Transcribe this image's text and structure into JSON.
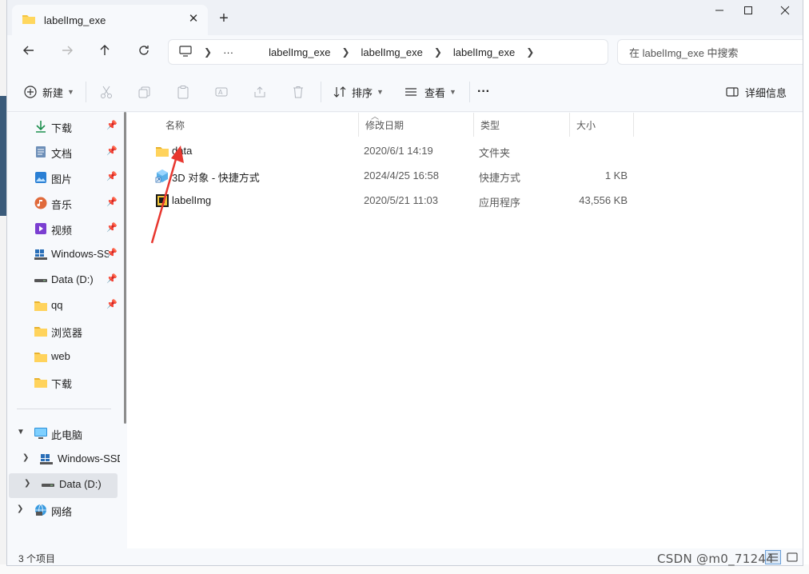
{
  "window": {
    "tab_title": "labelImg_exe",
    "close_tab": "✕",
    "new_tab": "+"
  },
  "nav": {
    "back_icon": "arrow-left-icon",
    "forward_icon": "arrow-right-icon",
    "up_icon": "arrow-up-icon",
    "refresh_icon": "refresh-icon",
    "breadcrumb": [
      "labelImg_exe",
      "labelImg_exe",
      "labelImg_exe"
    ],
    "ellipsis": "···",
    "search_placeholder": "在 labelImg_exe 中搜索"
  },
  "commands": {
    "new_label": "新建",
    "sort_label": "排序",
    "view_label": "查看",
    "more_label": "···",
    "details_label": "详细信息"
  },
  "sidebar": {
    "quick": [
      {
        "label": "下载",
        "icon": "download-icon",
        "pinned": true
      },
      {
        "label": "文档",
        "icon": "document-icon",
        "pinned": true
      },
      {
        "label": "图片",
        "icon": "picture-icon",
        "pinned": true
      },
      {
        "label": "音乐",
        "icon": "music-icon",
        "pinned": true
      },
      {
        "label": "视频",
        "icon": "video-icon",
        "pinned": true
      },
      {
        "label": "Windows-SSD",
        "icon": "windows-drive-icon",
        "pinned": true
      },
      {
        "label": "Data (D:)",
        "icon": "drive-icon",
        "pinned": true
      },
      {
        "label": "qq",
        "icon": "folder-icon",
        "pinned": true
      },
      {
        "label": "浏览器",
        "icon": "folder-icon",
        "pinned": false
      },
      {
        "label": "web",
        "icon": "folder-icon",
        "pinned": false
      },
      {
        "label": "下载",
        "icon": "folder-icon",
        "pinned": false
      }
    ],
    "tree": [
      {
        "label": "此电脑",
        "icon": "computer-icon",
        "expanded": true
      },
      {
        "label": "Windows-SSD",
        "icon": "windows-drive-icon"
      },
      {
        "label": "Data (D:)",
        "icon": "drive-icon",
        "selected": true
      },
      {
        "label": "网络",
        "icon": "network-icon"
      }
    ]
  },
  "columns": {
    "name": "名称",
    "date": "修改日期",
    "type": "类型",
    "size": "大小"
  },
  "files": [
    {
      "name": "data",
      "date": "2020/6/1 14:19",
      "type": "文件夹",
      "size": "",
      "icon": "folder-icon"
    },
    {
      "name": "3D 对象 - 快捷方式",
      "date": "2024/4/25 16:58",
      "type": "快捷方式",
      "size": "1 KB",
      "icon": "shortcut-icon"
    },
    {
      "name": "labelImg",
      "date": "2020/5/21 11:03",
      "type": "应用程序",
      "size": "43,556 KB",
      "icon": "app-icon"
    }
  ],
  "status": {
    "item_count": "3 个项目"
  },
  "watermark": "CSDN @m0_71244",
  "colors": {
    "accent": "#1a73c9",
    "folder": "#f4c542",
    "annotation_arrow": "#e8372f"
  }
}
